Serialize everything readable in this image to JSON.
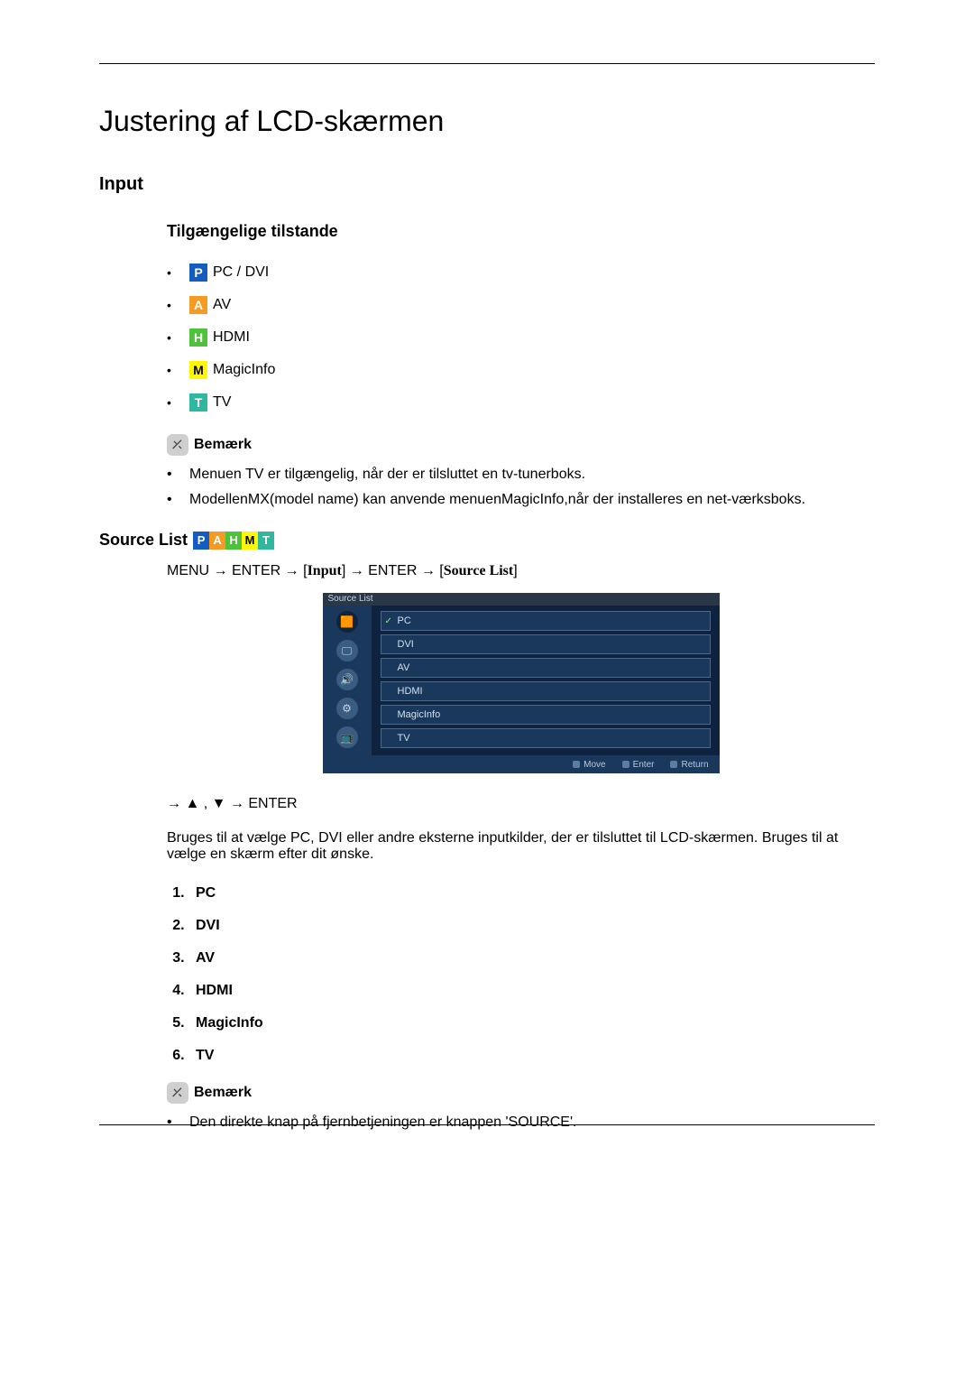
{
  "title": "Justering af LCD-skærmen",
  "section_input": "Input",
  "modes_heading": "Tilgængelige tilstande",
  "modes": [
    {
      "letter": "P",
      "color": "bg-blue",
      "label": "PC / DVI"
    },
    {
      "letter": "A",
      "color": "bg-orange",
      "label": "AV"
    },
    {
      "letter": "H",
      "color": "bg-green",
      "label": "HDMI"
    },
    {
      "letter": "M",
      "color": "bg-yellow",
      "label": "MagicInfo"
    },
    {
      "letter": "T",
      "color": "bg-teal",
      "label": "TV"
    }
  ],
  "note_label": "Bemærk",
  "notes1": [
    "Menuen TV er tilgængelig, når der er tilsluttet en tv-tunerboks.",
    "ModellenMX(model name) kan anvende menuenMagicInfo,når der installeres en net-værksboks."
  ],
  "source_list_label": "Source List",
  "badge_strip": [
    {
      "letter": "P",
      "color": "bg-blue"
    },
    {
      "letter": "A",
      "color": "bg-orange"
    },
    {
      "letter": "H",
      "color": "bg-green"
    },
    {
      "letter": "M",
      "color": "bg-yellow"
    },
    {
      "letter": "T",
      "color": "bg-teal"
    }
  ],
  "menu_path": {
    "menu": "MENU",
    "enter": "ENTER",
    "input_br": "Input",
    "source_br": "Source List"
  },
  "osd": {
    "title": "Source List",
    "items": [
      "PC",
      "DVI",
      "AV",
      "HDMI",
      "MagicInfo",
      "TV"
    ],
    "selected_index": 0,
    "footer": {
      "move": "Move",
      "enter": "Enter",
      "return": "Return"
    }
  },
  "nav_keys": "→ ▲ , ▼ → ENTER",
  "description": "Bruges til at vælge PC, DVI eller andre eksterne inputkilder, der er tilsluttet til LCD-skærmen. Bruges til at vælge en skærm efter dit ønske.",
  "num_items": [
    "PC",
    "DVI",
    "AV",
    "HDMI",
    "MagicInfo",
    "TV"
  ],
  "notes2": [
    "Den direkte knap på fjernbetjeningen er knappen 'SOURCE'."
  ]
}
